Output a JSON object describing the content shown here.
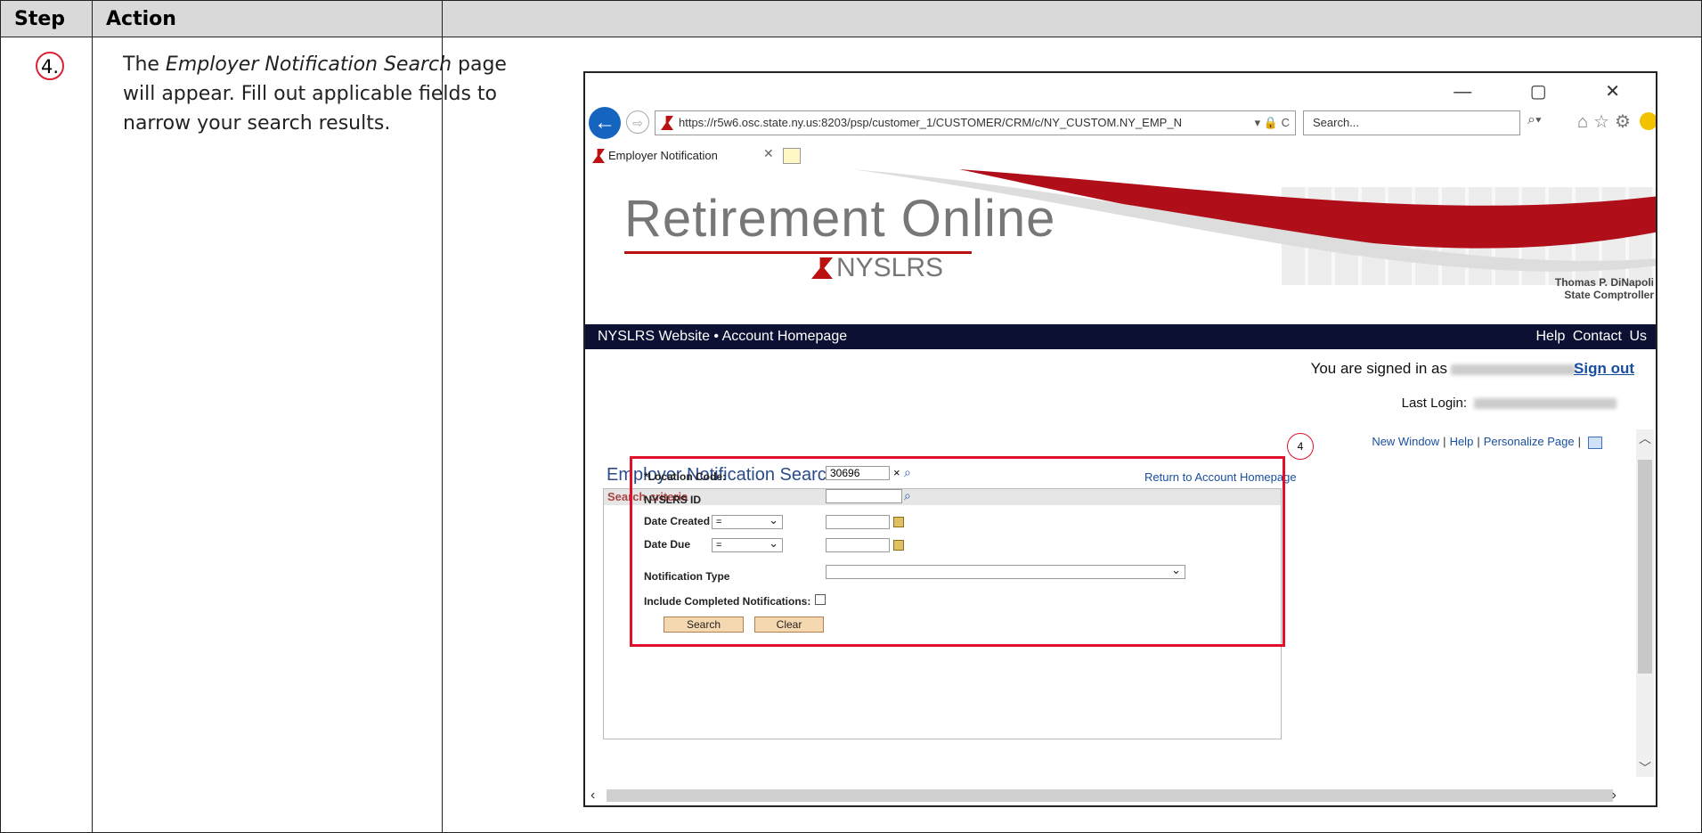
{
  "table": {
    "header_step": "Step",
    "header_action": "Action"
  },
  "step": {
    "number": "4.",
    "text_part1": "The ",
    "text_italic": "Employer Notification Search",
    "text_part2": " page will appear.  Fill out applicable fields to narrow your search results."
  },
  "browser": {
    "url": "https://r5w6.osc.state.ny.us:8203/psp/customer_1/CUSTOMER/CRM/c/NY_CUSTOM.NY_EMP_N",
    "url_controls": "▾ 🔒 C",
    "search_placeholder": "Search...",
    "tab_title": "Employer Notification",
    "window_controls": "— ▢ ✕"
  },
  "banner": {
    "logo_main": "Retirement Online",
    "logo_sub": "NYSLRS",
    "comptroller_name": "Thomas P. DiNapoli",
    "comptroller_title": "State Comptroller"
  },
  "nav": {
    "left": "NYSLRS Website  •  Account Homepage",
    "right": "Help   Contact Us"
  },
  "session": {
    "signed_in": "You are signed in as",
    "sign_out": "Sign out",
    "last_login": "Last Login:"
  },
  "links": {
    "new_window": "New Window",
    "help": "Help",
    "personalize": "Personalize Page"
  },
  "form": {
    "title": "Employer Notification Search",
    "return_link": "Return to Account Homepage",
    "section": "Search criteria",
    "location_label": "*Location Code:",
    "location_value": "30696",
    "clear_x": "×",
    "nyslrs_label": "NYSLRS ID",
    "date_created_label": "Date Created",
    "date_created_op": "=",
    "date_due_label": "Date Due",
    "date_due_op": "=",
    "notification_type_label": "Notification Type",
    "include_completed_label": "Include Completed Notifications:",
    "search_button": "Search",
    "clear_button": "Clear"
  },
  "callout": {
    "badge": "4"
  }
}
